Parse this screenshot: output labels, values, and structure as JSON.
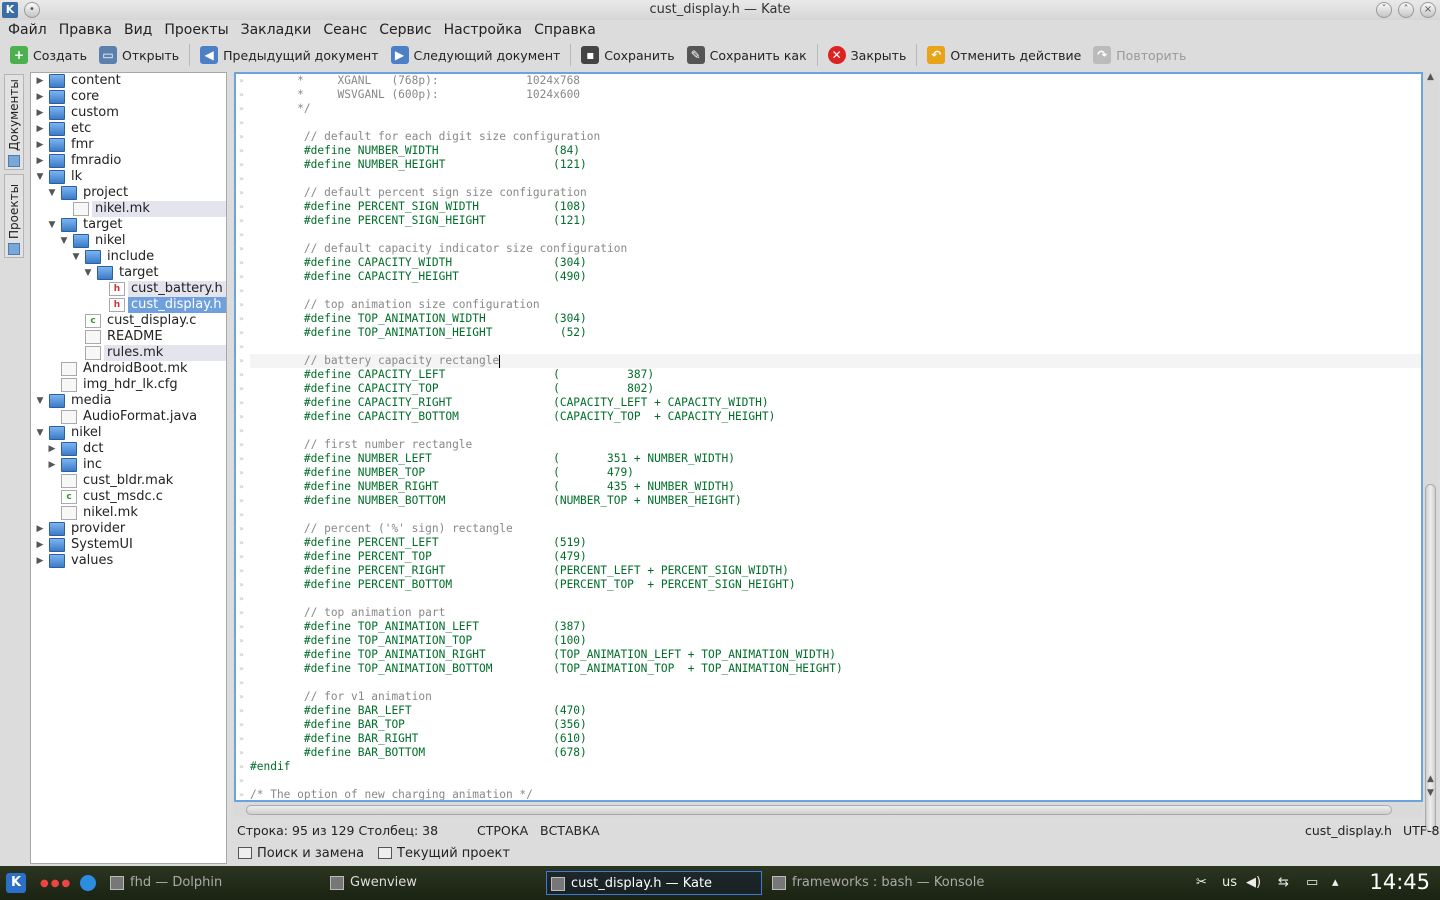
{
  "window": {
    "title": "cust_display.h — Kate"
  },
  "menu": [
    "Файл",
    "Правка",
    "Вид",
    "Проекты",
    "Закладки",
    "Сеанс",
    "Сервис",
    "Настройка",
    "Справка"
  ],
  "toolbar": {
    "create": "Создать",
    "open": "Открыть",
    "prev_doc": "Предыдущий документ",
    "next_doc": "Следующий документ",
    "save": "Сохранить",
    "save_as": "Сохранить как",
    "close": "Закрыть",
    "undo": "Отменить действие",
    "redo": "Повторить"
  },
  "sidetabs": {
    "documents": "Документы",
    "projects": "Проекты"
  },
  "tree": [
    {
      "label": "content",
      "depth": 0,
      "type": "folder",
      "arrow": "right"
    },
    {
      "label": "core",
      "depth": 0,
      "type": "folder",
      "arrow": "right"
    },
    {
      "label": "custom",
      "depth": 0,
      "type": "folder",
      "arrow": "right"
    },
    {
      "label": "etc",
      "depth": 0,
      "type": "folder",
      "arrow": "right"
    },
    {
      "label": "fmr",
      "depth": 0,
      "type": "folder",
      "arrow": "right"
    },
    {
      "label": "fmradio",
      "depth": 0,
      "type": "folder",
      "arrow": "right"
    },
    {
      "label": "lk",
      "depth": 0,
      "type": "folder",
      "arrow": "down"
    },
    {
      "label": "project",
      "depth": 1,
      "type": "folder",
      "arrow": "down"
    },
    {
      "label": "nikel.mk",
      "depth": 2,
      "type": "file",
      "arrow": "",
      "state": "light"
    },
    {
      "label": "target",
      "depth": 1,
      "type": "folder",
      "arrow": "down"
    },
    {
      "label": "nikel",
      "depth": 2,
      "type": "folder",
      "arrow": "down"
    },
    {
      "label": "include",
      "depth": 3,
      "type": "folder",
      "arrow": "down"
    },
    {
      "label": "target",
      "depth": 4,
      "type": "folder",
      "arrow": "down"
    },
    {
      "label": "cust_battery.h",
      "depth": 5,
      "type": "hfile",
      "arrow": "",
      "state": "light"
    },
    {
      "label": "cust_display.h",
      "depth": 5,
      "type": "hfile",
      "arrow": "",
      "state": "dark"
    },
    {
      "label": "cust_display.c",
      "depth": 3,
      "type": "cfile",
      "arrow": ""
    },
    {
      "label": "README",
      "depth": 3,
      "type": "file",
      "arrow": ""
    },
    {
      "label": "rules.mk",
      "depth": 3,
      "type": "file",
      "arrow": "",
      "state": "light"
    },
    {
      "label": "AndroidBoot.mk",
      "depth": 1,
      "type": "file",
      "arrow": ""
    },
    {
      "label": "img_hdr_lk.cfg",
      "depth": 1,
      "type": "file",
      "arrow": ""
    },
    {
      "label": "media",
      "depth": 0,
      "type": "folder",
      "arrow": "down"
    },
    {
      "label": "AudioFormat.java",
      "depth": 1,
      "type": "file",
      "arrow": ""
    },
    {
      "label": "nikel",
      "depth": 0,
      "type": "folder",
      "arrow": "down"
    },
    {
      "label": "dct",
      "depth": 1,
      "type": "folder",
      "arrow": "right"
    },
    {
      "label": "inc",
      "depth": 1,
      "type": "folder",
      "arrow": "right"
    },
    {
      "label": "cust_bldr.mak",
      "depth": 1,
      "type": "file",
      "arrow": ""
    },
    {
      "label": "cust_msdc.c",
      "depth": 1,
      "type": "cfile",
      "arrow": ""
    },
    {
      "label": "nikel.mk",
      "depth": 1,
      "type": "file",
      "arrow": ""
    },
    {
      "label": "provider",
      "depth": 0,
      "type": "folder",
      "arrow": "right"
    },
    {
      "label": "SystemUI",
      "depth": 0,
      "type": "folder",
      "arrow": "right"
    },
    {
      "label": "values",
      "depth": 0,
      "type": "folder",
      "arrow": "right"
    }
  ],
  "code": [
    {
      "t": "cm",
      "s": "       *     XGANL   (768p):             1024x768"
    },
    {
      "t": "cm",
      "s": "       *     WSVGANL (600p):             1024x600"
    },
    {
      "t": "cm",
      "s": "       */"
    },
    {
      "t": "",
      "s": ""
    },
    {
      "t": "cm",
      "s": "        // default for each digit size configuration"
    },
    {
      "t": "pp",
      "s": "        #define NUMBER_WIDTH                 (84)"
    },
    {
      "t": "pp",
      "s": "        #define NUMBER_HEIGHT                (121)"
    },
    {
      "t": "",
      "s": ""
    },
    {
      "t": "cm",
      "s": "        // default percent sign size configuration"
    },
    {
      "t": "pp",
      "s": "        #define PERCENT_SIGN_WIDTH           (108)"
    },
    {
      "t": "pp",
      "s": "        #define PERCENT_SIGN_HEIGHT          (121)"
    },
    {
      "t": "",
      "s": ""
    },
    {
      "t": "cm",
      "s": "        // default capacity indicator size configuration"
    },
    {
      "t": "pp",
      "s": "        #define CAPACITY_WIDTH               (304)"
    },
    {
      "t": "pp",
      "s": "        #define CAPACITY_HEIGHT              (490)"
    },
    {
      "t": "",
      "s": ""
    },
    {
      "t": "cm",
      "s": "        // top animation size configuration"
    },
    {
      "t": "pp",
      "s": "        #define TOP_ANIMATION_WIDTH          (304)"
    },
    {
      "t": "pp",
      "s": "        #define TOP_ANIMATION_HEIGHT          (52)"
    },
    {
      "t": "",
      "s": ""
    },
    {
      "t": "cm",
      "s": "        // battery capacity rectangle",
      "cur": true
    },
    {
      "t": "pp",
      "s": "        #define CAPACITY_LEFT                (          387)"
    },
    {
      "t": "pp",
      "s": "        #define CAPACITY_TOP                 (          802)"
    },
    {
      "t": "pp",
      "s": "        #define CAPACITY_RIGHT               (CAPACITY_LEFT + CAPACITY_WIDTH)"
    },
    {
      "t": "pp",
      "s": "        #define CAPACITY_BOTTOM              (CAPACITY_TOP  + CAPACITY_HEIGHT)"
    },
    {
      "t": "",
      "s": ""
    },
    {
      "t": "cm",
      "s": "        // first number rectangle"
    },
    {
      "t": "pp",
      "s": "        #define NUMBER_LEFT                  (       351 + NUMBER_WIDTH)"
    },
    {
      "t": "pp",
      "s": "        #define NUMBER_TOP                   (       479)"
    },
    {
      "t": "pp",
      "s": "        #define NUMBER_RIGHT                 (       435 + NUMBER_WIDTH)"
    },
    {
      "t": "pp",
      "s": "        #define NUMBER_BOTTOM                (NUMBER_TOP + NUMBER_HEIGHT)"
    },
    {
      "t": "",
      "s": ""
    },
    {
      "t": "cm",
      "s": "        // percent ('%' sign) rectangle"
    },
    {
      "t": "pp",
      "s": "        #define PERCENT_LEFT                 (519)"
    },
    {
      "t": "pp",
      "s": "        #define PERCENT_TOP                  (479)"
    },
    {
      "t": "pp",
      "s": "        #define PERCENT_RIGHT                (PERCENT_LEFT + PERCENT_SIGN_WIDTH)"
    },
    {
      "t": "pp",
      "s": "        #define PERCENT_BOTTOM               (PERCENT_TOP  + PERCENT_SIGN_HEIGHT)"
    },
    {
      "t": "",
      "s": ""
    },
    {
      "t": "cm",
      "s": "        // top animation part"
    },
    {
      "t": "pp",
      "s": "        #define TOP_ANIMATION_LEFT           (387)"
    },
    {
      "t": "pp",
      "s": "        #define TOP_ANIMATION_TOP            (100)"
    },
    {
      "t": "pp",
      "s": "        #define TOP_ANIMATION_RIGHT          (TOP_ANIMATION_LEFT + TOP_ANIMATION_WIDTH)"
    },
    {
      "t": "pp",
      "s": "        #define TOP_ANIMATION_BOTTOM         (TOP_ANIMATION_TOP  + TOP_ANIMATION_HEIGHT)"
    },
    {
      "t": "",
      "s": ""
    },
    {
      "t": "cm",
      "s": "        // for v1 animation"
    },
    {
      "t": "pp",
      "s": "        #define BAR_LEFT                     (470)"
    },
    {
      "t": "pp",
      "s": "        #define BAR_TOP                      (356)"
    },
    {
      "t": "pp",
      "s": "        #define BAR_RIGHT                    (610)"
    },
    {
      "t": "pp",
      "s": "        #define BAR_BOTTOM                   (678)"
    },
    {
      "t": "pp",
      "s": "#endif"
    },
    {
      "t": "",
      "s": ""
    },
    {
      "t": "cm",
      "s": "/* The option of new charging animation */"
    }
  ],
  "status": {
    "position": "Строка: 95 из 129 Столбец: 38",
    "mode1": "СТРОКА",
    "mode2": "ВСТАВКА",
    "filename": "cust_display.h",
    "encoding": "UTF-8"
  },
  "bottom_tabs": {
    "search": "Поиск и замена",
    "project": "Текущий проект"
  },
  "taskbar": {
    "tasks": [
      "fhd — Dolphin",
      "Gwenview",
      "cust_display.h — Kate",
      "frameworks : bash — Konsole"
    ],
    "layout": "us",
    "clock": "14:45"
  },
  "colors": {
    "accent": "#6aa4de",
    "comment": "#898887",
    "preprocessor": "#006e28",
    "selection": "#6f9fdc"
  }
}
